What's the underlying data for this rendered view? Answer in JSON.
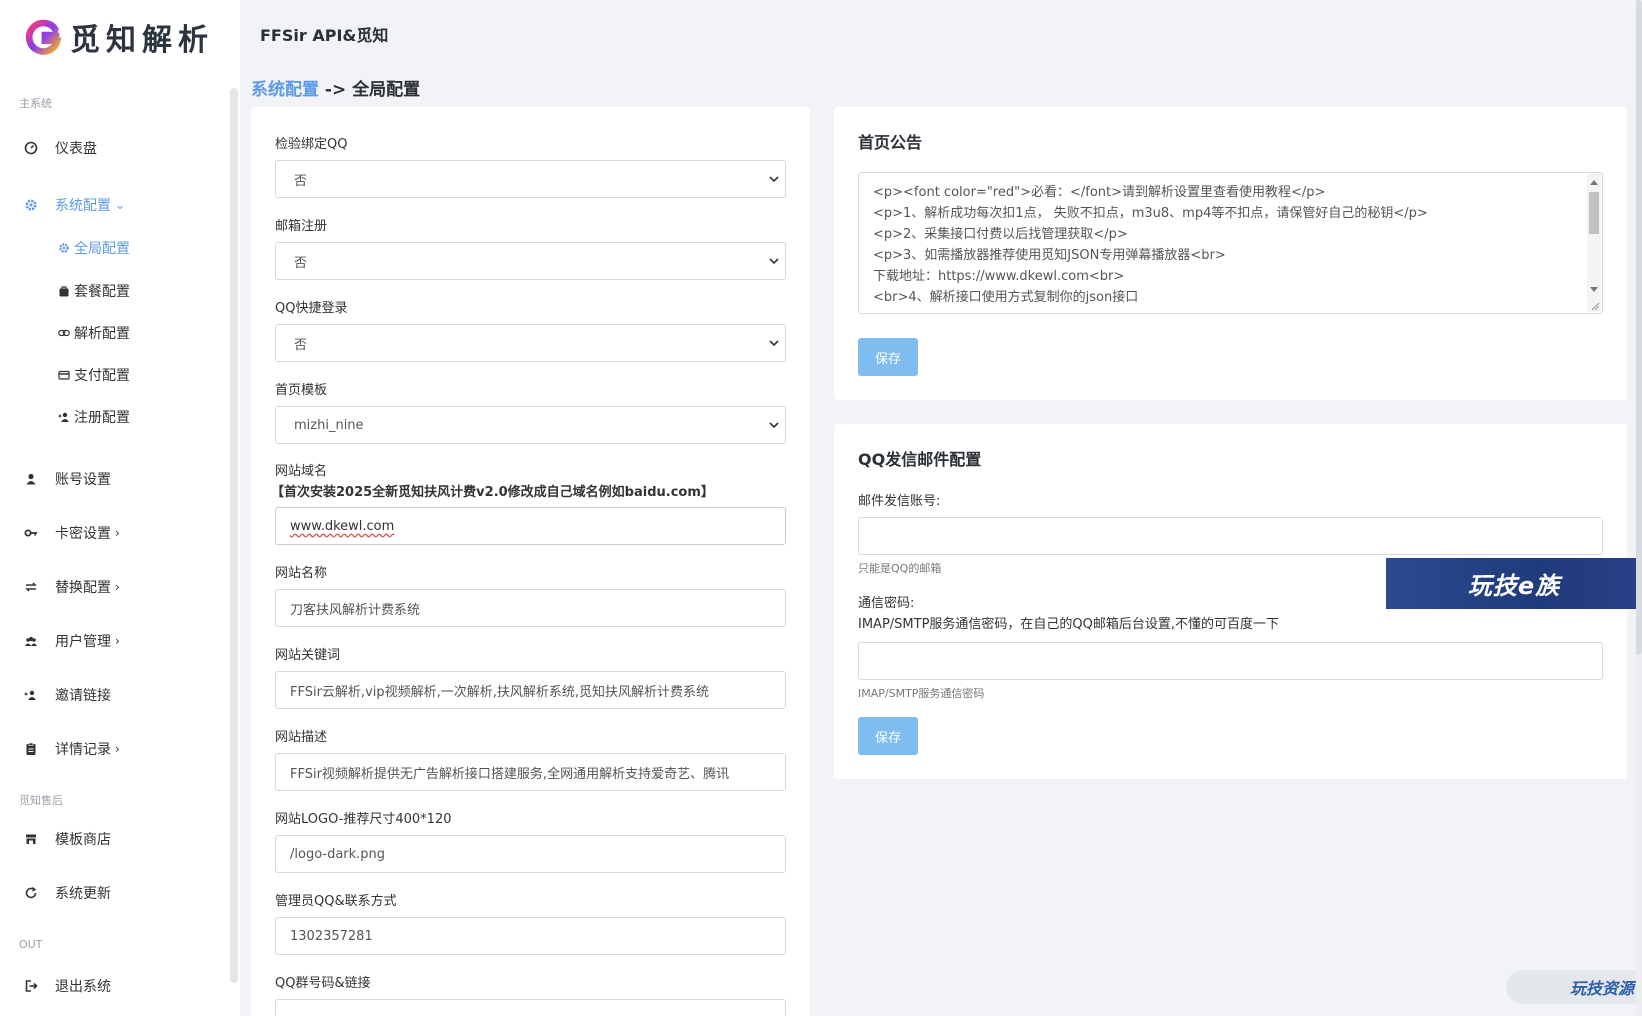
{
  "brand": {
    "name": "觅知解析",
    "logo_icon": "g-logo-icon"
  },
  "topbar": {
    "title": "FFSir API&觅知"
  },
  "breadcrumb": {
    "parent": "系统配置",
    "separator": "->",
    "current": "全局配置"
  },
  "sidebar": {
    "section_main": "主系统",
    "section_after": "觅知售后",
    "section_out": "OUT",
    "items": {
      "dashboard": "仪表盘",
      "system_config": "系统配置",
      "account": "账号设置",
      "card_key": "卡密设置",
      "replace": "替换配置",
      "users": "用户管理",
      "invite": "邀请链接",
      "records": "详情记录",
      "template_store": "模板商店",
      "update": "系统更新",
      "logout": "退出系统"
    },
    "sub_items": {
      "global": "全局配置",
      "package": "套餐配置",
      "parse": "解析配置",
      "pay": "支付配置",
      "register": "注册配置"
    }
  },
  "form": {
    "qq_bind": {
      "label": "检验绑定QQ",
      "value": "否"
    },
    "email_register": {
      "label": "邮箱注册",
      "value": "否"
    },
    "qq_login": {
      "label": "QQ快捷登录",
      "value": "否"
    },
    "home_template": {
      "label": "首页模板",
      "value": "mizhi_nine"
    },
    "domain": {
      "label": "网站域名",
      "help": "【首次安装2025全新觅知扶风计费v2.0修改成自己域名例如baidu.com】",
      "value": "www.dkewl.com"
    },
    "site_name": {
      "label": "网站名称",
      "value": "刀客扶风解析计费系统"
    },
    "keywords": {
      "label": "网站关键词",
      "value": "FFSir云解析,vip视频解析,一次解析,扶风解析系统,觅知扶风解析计费系统"
    },
    "description": {
      "label": "网站描述",
      "value": "FFSir视频解析提供无广告解析接口搭建服务,全网通用解析支持爱奇艺、腾讯"
    },
    "logo": {
      "label": "网站LOGO-推荐尺寸400*120",
      "value": "/logo-dark.png"
    },
    "admin_qq": {
      "label": "管理员QQ&联系方式",
      "value": "1302357281"
    },
    "qq_group": {
      "label": "QQ群号码&链接"
    }
  },
  "notice": {
    "title": "首页公告",
    "lines": [
      "<p><font color=\"red\">必看：</font>请到解析设置里查看使用教程</p>",
      "<p>1、解析成功每次扣1点， 失败不扣点，m3u8、mp4等不扣点，请保管好自己的秘钥</p>",
      "<p>2、采集接口付费以后找管理获取</p>",
      "<p>3、如需播放器推荐使用觅知JSON专用弹幕播放器<br>",
      "下载地址：https://www.dkewl.com<br>",
      "<br>4、解析接口使用方式复制你的json接口"
    ],
    "save_label": "保存"
  },
  "mail": {
    "title": "QQ发信邮件配置",
    "account_label": "邮件发信账号:",
    "account_hint": "只能是QQ的邮箱",
    "password_label": "通信密码:",
    "password_help": "IMAP/SMTP服务通信密码，在自己的QQ邮箱后台设置,不懂的可百度一下",
    "password_hint": "IMAP/SMTP服务通信密码",
    "save_label": "保存"
  },
  "overlays": {
    "banner": "玩技e族",
    "watermark": "玩技资源"
  },
  "colors": {
    "accent": "#5b9be8",
    "button": "#7fbdf0",
    "background": "#f2f3f7"
  }
}
